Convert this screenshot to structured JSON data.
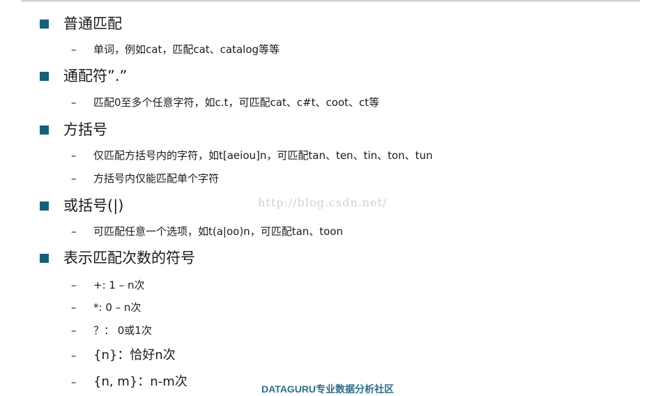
{
  "sections": [
    {
      "heading": "普通匹配",
      "items": [
        "单词，例如cat，匹配cat、catalog等等"
      ]
    },
    {
      "heading": "通配符”.”",
      "items": [
        "匹配0至多个任意字符，如c.t，可匹配cat、c#t、coot、ct等"
      ]
    },
    {
      "heading": "方括号",
      "items": [
        "仅匹配方括号内的字符，如t[aeiou]n，可匹配tan、ten、tin、ton、tun",
        "方括号内仅能匹配单个字符"
      ]
    },
    {
      "heading": "或括号(|)",
      "items": [
        "可匹配任意一个选项，如t(a|oo)n，可匹配tan、toon"
      ]
    },
    {
      "heading": "表示匹配次数的符号",
      "items": [
        "+: 1 – n次",
        "*: 0 – n次",
        "？： 0或1次",
        "{n}：恰好n次",
        "{n, m}：n-m次"
      ]
    }
  ],
  "dash": "–",
  "watermark": "http://blog.csdn.net/",
  "footer": "DATAGURU专业数据分析社区",
  "colors": {
    "bullet": "#17607a",
    "footer": "#2e6d8a",
    "watermark": "#d0d0d0"
  }
}
